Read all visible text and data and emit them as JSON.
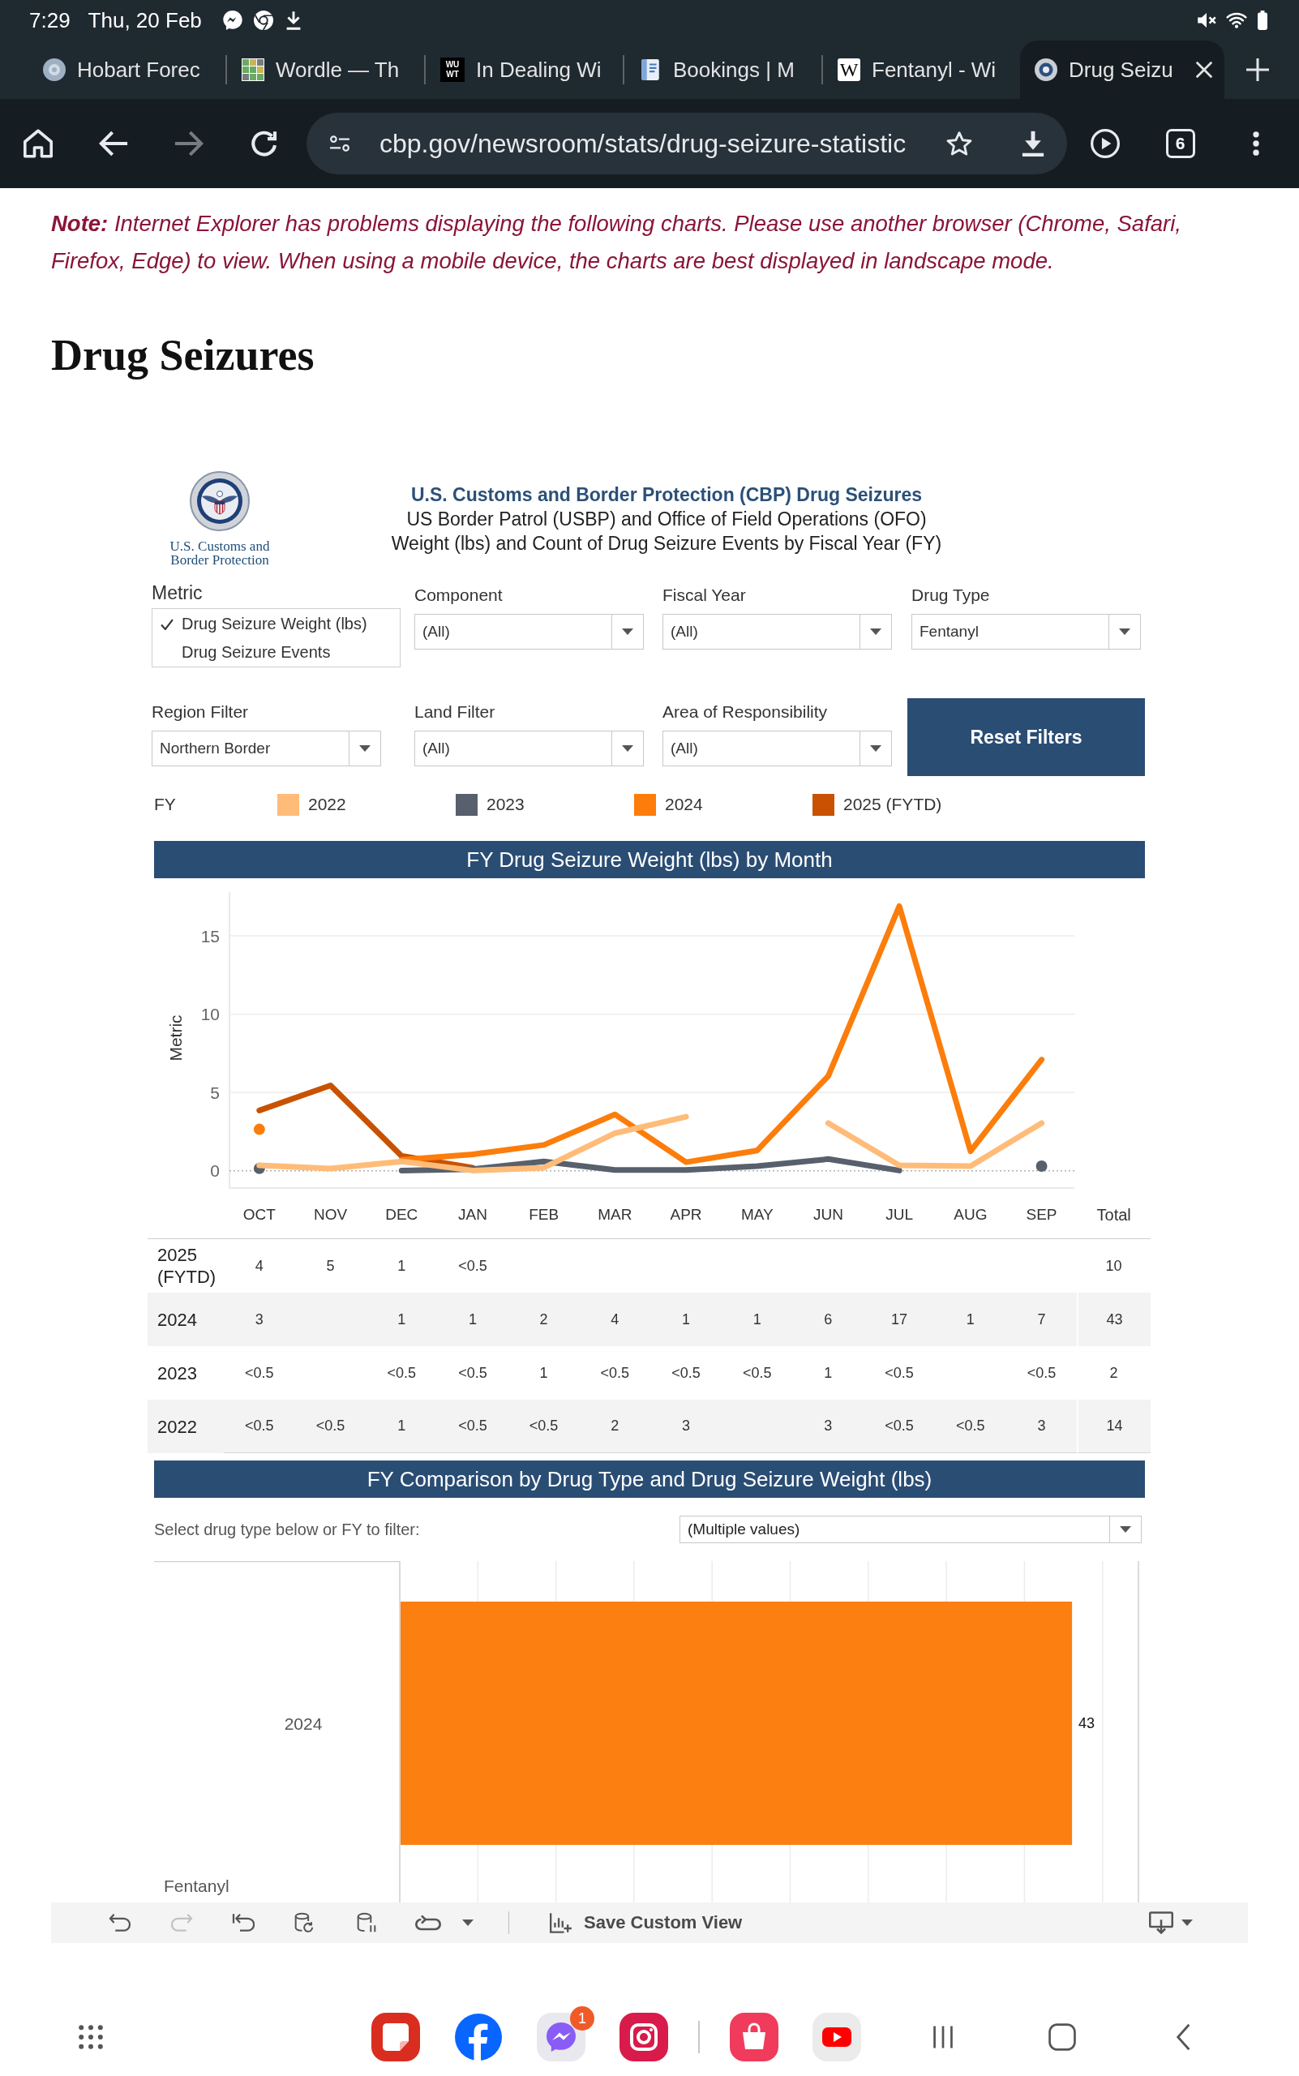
{
  "status_bar": {
    "time": "7:29",
    "date": "Thu, 20 Feb"
  },
  "tabs": [
    {
      "title": "Hobart Forec",
      "kind": "round",
      "selected": false
    },
    {
      "title": "Wordle — Th",
      "kind": "grid",
      "selected": false
    },
    {
      "title": "In Dealing Wi",
      "kind": "dark_letters",
      "icon_text": "WU WT",
      "selected": false
    },
    {
      "title": "Bookings | M",
      "kind": "document",
      "selected": false
    },
    {
      "title": "Fentanyl - Wi",
      "kind": "light_letters",
      "icon_text": "W",
      "selected": false
    },
    {
      "title": "Drug Seizu",
      "kind": "seal",
      "selected": true
    }
  ],
  "toolbar": {
    "nav_buttons": [
      {
        "kind": "home",
        "disabled": false
      },
      {
        "kind": "back",
        "disabled": false
      },
      {
        "kind": "forward",
        "disabled": true
      },
      {
        "kind": "reload",
        "disabled": false
      }
    ],
    "url": "cbp.gov/newsroom/stats/drug-seizure-statistic",
    "tab_count": "6"
  },
  "note": "**Note:** Internet Explorer has problems displaying the following charts. Please use another browser (Chrome, Safari, Firefox, Edge) to view. When using a mobile device, the charts are best displayed in landscape mode.",
  "heading": "Drug Seizures",
  "dashboard": {
    "logo_text": "U.S. Customs and Border Protection",
    "title": "U.S. Customs and Border Protection (CBP) Drug Seizures",
    "subtitles": [
      "US Border Patrol (USBP) and Office of Field Operations (OFO)",
      "Weight (lbs) and Count of Drug Seizure Events by Fiscal Year (FY)"
    ],
    "metric": {
      "label": "Metric",
      "options": [
        {
          "label": "Drug Seizure Weight (lbs)",
          "selected": true
        },
        {
          "label": "Drug Seizure Events",
          "selected": false
        }
      ]
    },
    "filters": [
      {
        "label": "Component",
        "value": "(All)"
      },
      {
        "label": "Fiscal Year",
        "value": "(All)"
      },
      {
        "label": "Drug Type",
        "value": "Fentanyl"
      },
      {
        "label": "Region Filter",
        "value": "Northern Border"
      },
      {
        "label": "Land Filter",
        "value": "(All)"
      },
      {
        "label": "Area of Responsibility",
        "value": "(All)"
      }
    ],
    "reset_button": "Reset Filters",
    "monthly_chart": {
      "legend_title": "FY",
      "header": "FY Drug Seizure Weight (lbs) by Month",
      "chart_data": {
        "type": "line",
        "ylabel": "Metric",
        "categories": [
          "OCT",
          "NOV",
          "DEC",
          "JAN",
          "FEB",
          "MAR",
          "APR",
          "MAY",
          "JUN",
          "JUL",
          "AUG",
          "SEP"
        ],
        "ylim": [
          -1.1,
          17.8
        ],
        "yticks": [
          0,
          5,
          10,
          15
        ],
        "grid": true,
        "ref_lines": [
          {
            "axis": "y",
            "value": 0
          }
        ],
        "series": [
          {
            "name": "2022",
            "color": "#ffbc79",
            "values": [
              0.35,
              0.15,
              0.6,
              0.02,
              0.2,
              2.4,
              3.45,
              null,
              3.05,
              0.35,
              0.3,
              3.05
            ]
          },
          {
            "name": "2023",
            "color": "#57606c",
            "values": [
              0.15,
              null,
              0.02,
              0.1,
              0.6,
              0.05,
              0.05,
              0.3,
              0.75,
              0.02,
              null,
              0.3
            ]
          },
          {
            "name": "2024",
            "color": "#fc7d0b",
            "values": [
              2.65,
              null,
              0.7,
              1.05,
              1.65,
              3.6,
              0.55,
              1.3,
              6.05,
              16.9,
              1.25,
              7.1
            ]
          },
          {
            "name": "2025 (FYTD)",
            "color": "#c85200",
            "values": [
              3.85,
              5.45,
              0.95,
              0.2,
              null,
              null,
              null,
              null,
              null,
              null,
              null,
              null
            ]
          }
        ]
      }
    },
    "table": {
      "total_label": "Total",
      "rows": [
        {
          "label": "2025 (FYTD)",
          "cells": [
            "4",
            "5",
            "1",
            "<0.5",
            null,
            null,
            null,
            null,
            null,
            null,
            null,
            null
          ],
          "total": "10"
        },
        {
          "label": "2024",
          "cells": [
            "3",
            null,
            "1",
            "1",
            "2",
            "4",
            "1",
            "1",
            "6",
            "17",
            "1",
            "7"
          ],
          "total": "43"
        },
        {
          "label": "2023",
          "cells": [
            "<0.5",
            null,
            "<0.5",
            "<0.5",
            "1",
            "<0.5",
            "<0.5",
            "<0.5",
            "1",
            "<0.5",
            null,
            "<0.5"
          ],
          "total": "2"
        },
        {
          "label": "2022",
          "cells": [
            "<0.5",
            "<0.5",
            "1",
            "<0.5",
            "<0.5",
            "2",
            "3",
            null,
            "3",
            "<0.5",
            "<0.5",
            "3"
          ],
          "total": "14"
        }
      ]
    },
    "comparison": {
      "header": "FY Comparison by Drug Type and Drug Seizure Weight (lbs)",
      "filter_label": "Select drug type below or FY to filter:",
      "filter_value": "(Multiple values)",
      "bars": [
        {
          "label": "2024",
          "value_label": "43"
        }
      ],
      "group_label": "Fentanyl"
    }
  },
  "tableau_toolbar": {
    "buttons": [
      {
        "kind": "undo",
        "disabled": false
      },
      {
        "kind": "redo",
        "disabled": true
      },
      {
        "kind": "revert",
        "disabled": false
      },
      {
        "kind": "refresh",
        "disabled": false
      },
      {
        "kind": "pause",
        "disabled": false
      },
      {
        "kind": "replay",
        "disabled": false
      }
    ],
    "save_label": "Save Custom View"
  },
  "nav_bar": {
    "favorites": [
      {
        "kind": "notes"
      },
      {
        "kind": "social"
      },
      {
        "kind": "chat",
        "badge": "1"
      },
      {
        "kind": "camera"
      }
    ],
    "recent": [
      {
        "kind": "store"
      },
      {
        "kind": "video"
      }
    ]
  }
}
